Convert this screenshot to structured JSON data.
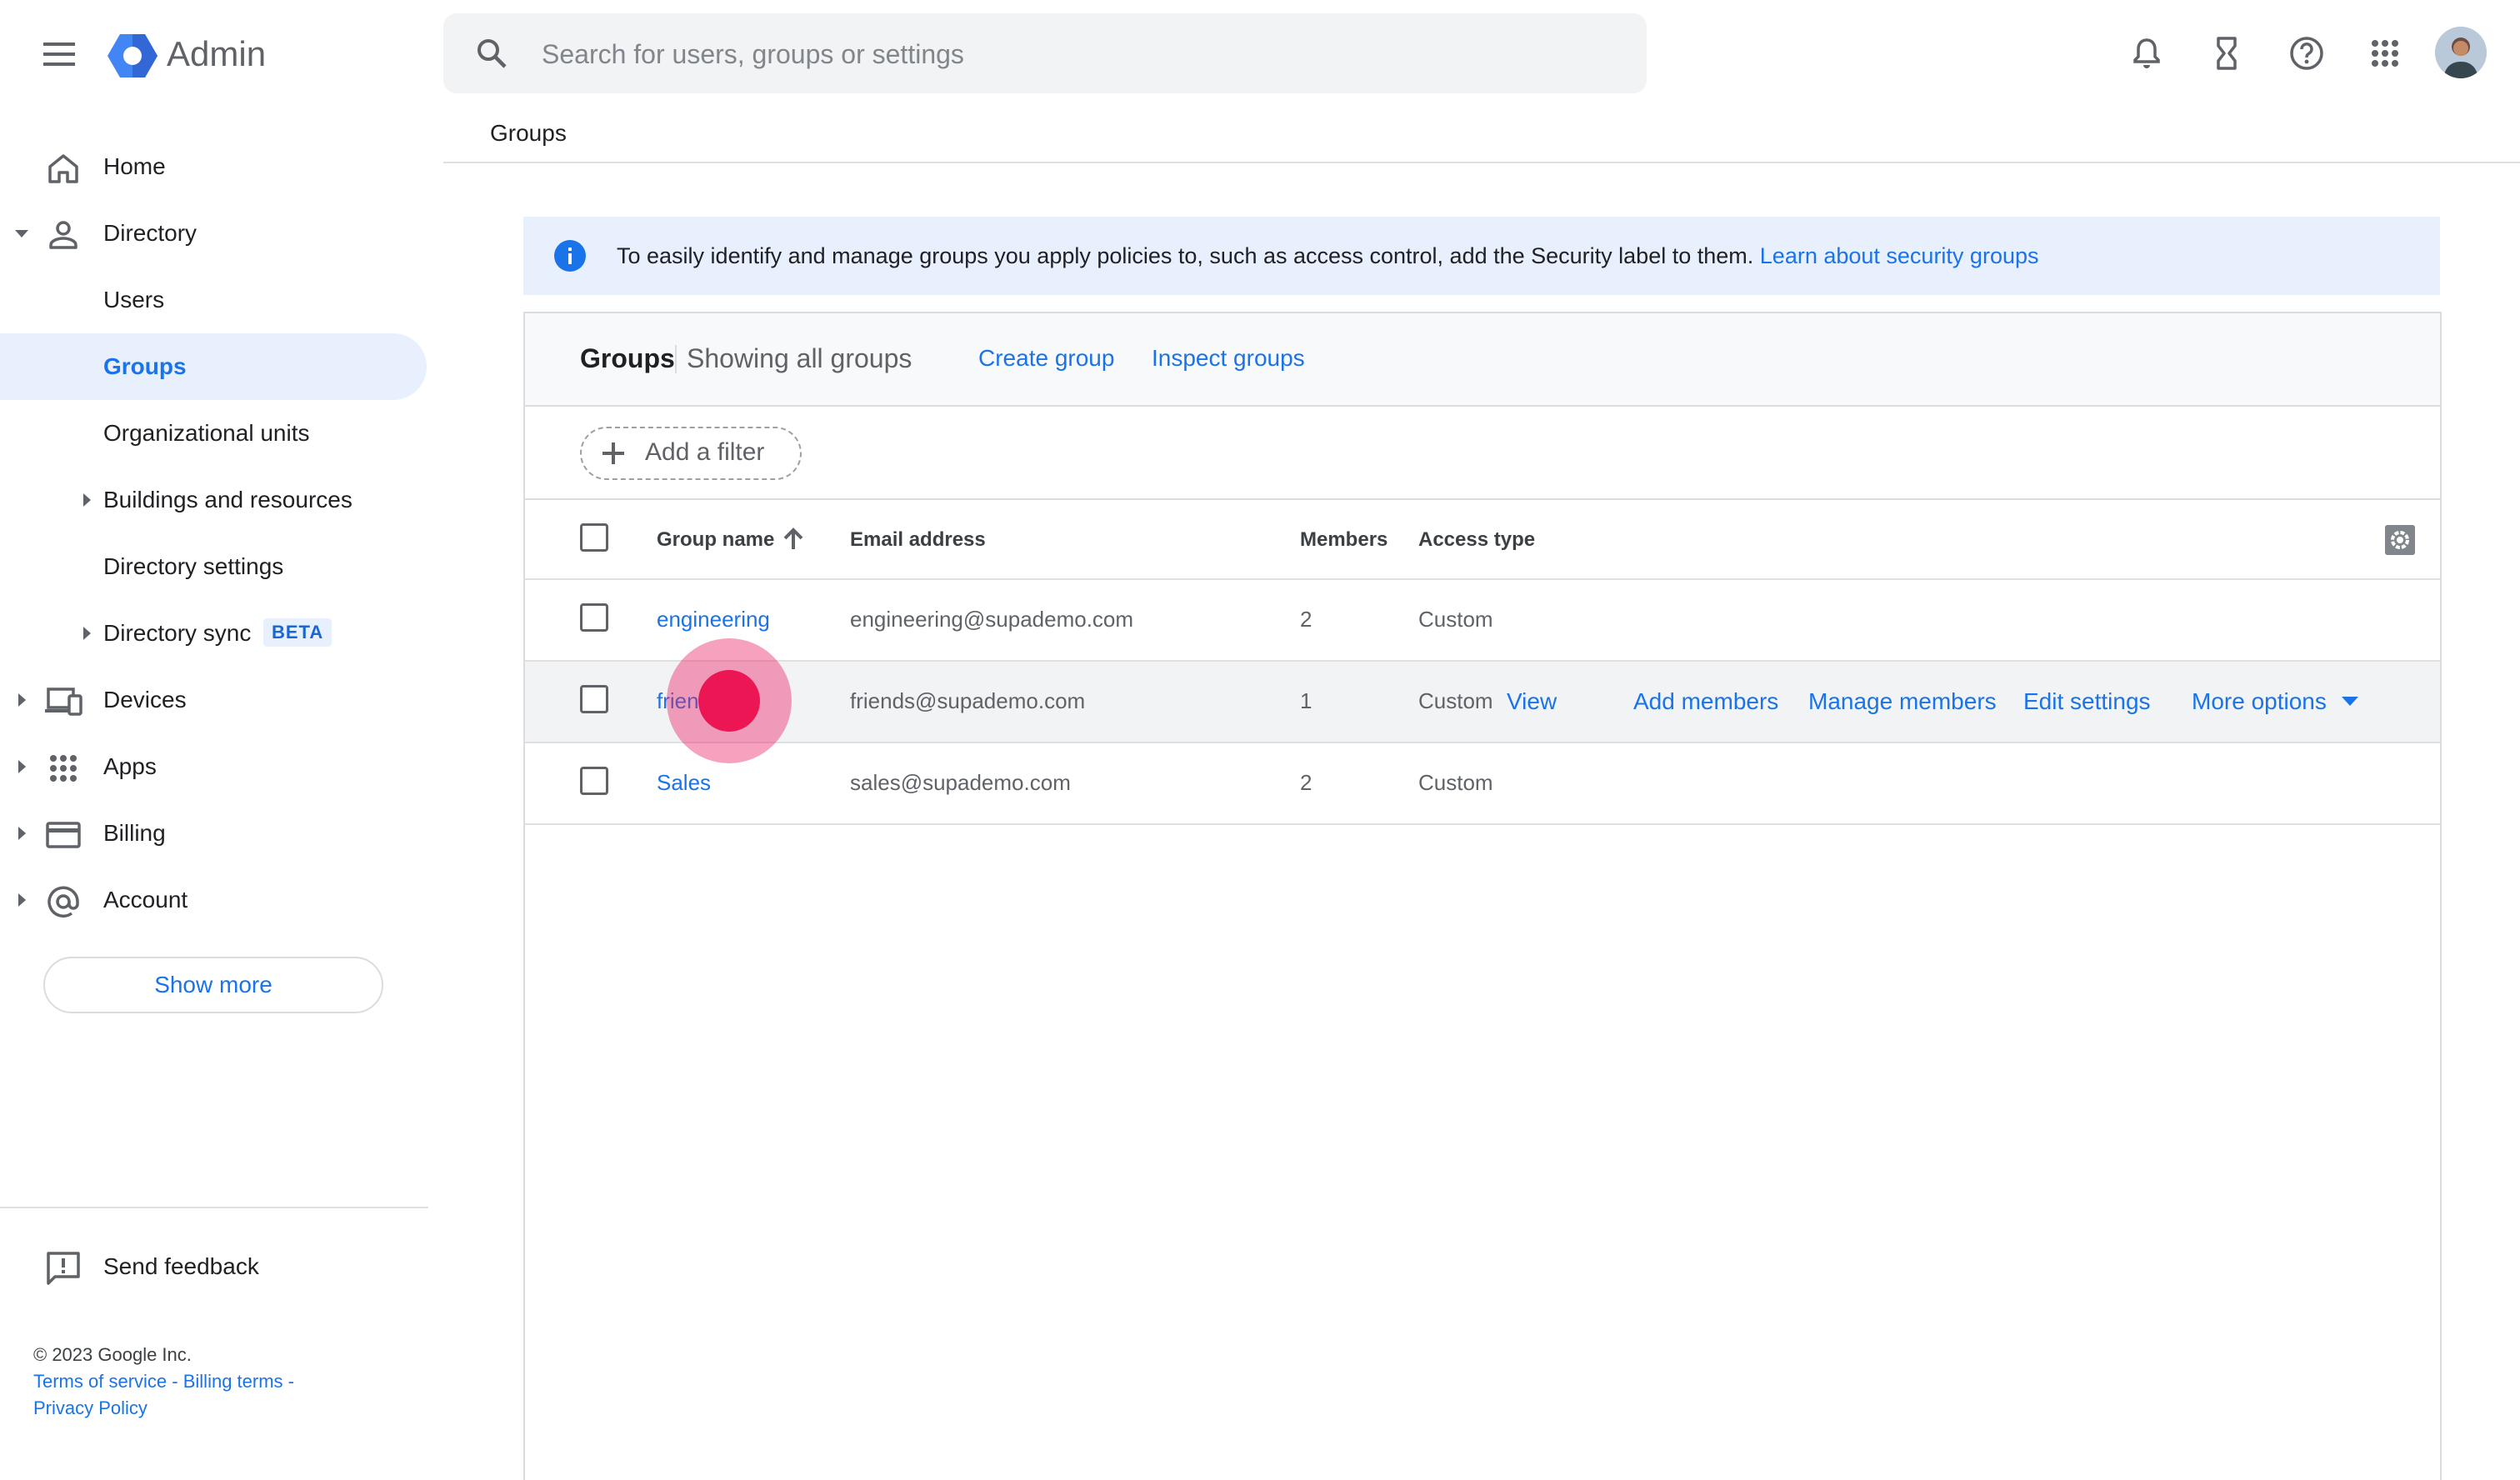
{
  "app": {
    "name": "Admin",
    "brand_color": "#1a73e8"
  },
  "search": {
    "placeholder": "Search for users, groups or settings"
  },
  "breadcrumb": {
    "current": "Groups"
  },
  "sidebar": {
    "items": [
      {
        "label": "Home",
        "icon": "home-icon"
      },
      {
        "label": "Directory",
        "icon": "person-icon",
        "expanded": true
      },
      {
        "label": "Users"
      },
      {
        "label": "Groups",
        "active": true
      },
      {
        "label": "Organizational units"
      },
      {
        "label": "Buildings and resources"
      },
      {
        "label": "Directory settings"
      },
      {
        "label": "Directory sync",
        "badge": "BETA"
      },
      {
        "label": "Devices",
        "icon": "devices-icon"
      },
      {
        "label": "Apps",
        "icon": "apps-grid-icon"
      },
      {
        "label": "Billing",
        "icon": "credit-card-icon"
      },
      {
        "label": "Account",
        "icon": "at-sign-icon"
      }
    ],
    "show_more": "Show more",
    "send_feedback": "Send feedback",
    "footer": {
      "copyright": "© 2023 Google Inc.",
      "terms": "Terms of service",
      "billing_terms": "Billing terms",
      "privacy": "Privacy Policy"
    }
  },
  "banner": {
    "text": "To easily identify and manage groups you apply policies to, such as access control, add the Security label to them. ",
    "link": "Learn about security groups"
  },
  "panel": {
    "title": "Groups",
    "subtitle": "Showing all groups",
    "create_group": "Create group",
    "inspect_groups": "Inspect groups",
    "add_filter": "Add a filter",
    "columns": [
      "Group name",
      "Email address",
      "Members",
      "Access type"
    ],
    "rows": [
      {
        "name": "engineering",
        "email": "engineering@supademo.com",
        "members": "2",
        "access": "Custom"
      },
      {
        "name": "frien",
        "email": "friends@supademo.com",
        "members": "1",
        "access": "Custom"
      },
      {
        "name": "Sales",
        "email": "sales@supademo.com",
        "members": "2",
        "access": "Custom"
      }
    ],
    "row_actions": {
      "view": "View",
      "add_members": "Add members",
      "manage_members": "Manage members",
      "edit_settings": "Edit settings",
      "more_options": "More options"
    }
  }
}
